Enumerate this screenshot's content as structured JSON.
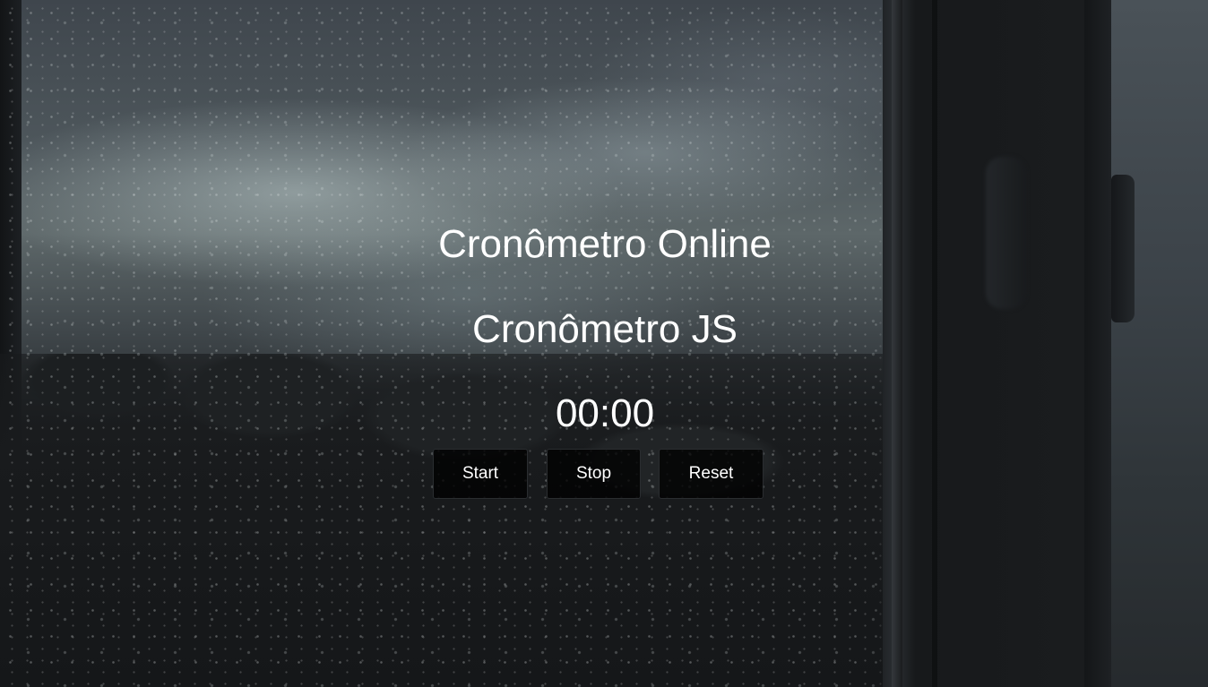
{
  "page": {
    "title": "Cronômetro Online",
    "subtitle": "Cronômetro JS"
  },
  "stopwatch": {
    "display": "00:00"
  },
  "controls": {
    "start_label": "Start",
    "stop_label": "Stop",
    "reset_label": "Reset"
  },
  "theme": {
    "text_color": "#ffffff",
    "button_background": "#000000",
    "background_image": "rainy-window-photo"
  }
}
